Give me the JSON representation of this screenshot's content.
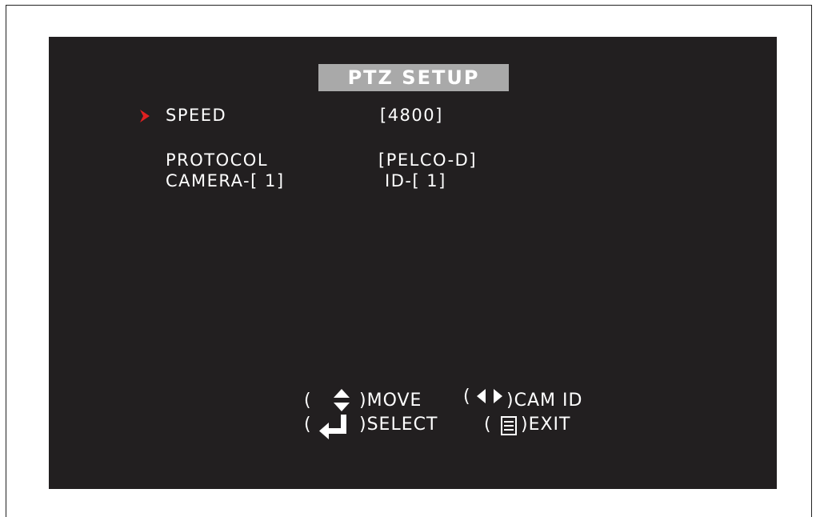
{
  "title": "PTZ SETUP",
  "menu": {
    "cursor_icon": "chevron-right-icon",
    "cursor_color": "#e02020",
    "speed_label": "SPEED",
    "speed_value": "[4800]",
    "protocol_label": "PROTOCOL",
    "protocol_value": "[PELCO-D]",
    "camera_label": "CAMERA-[ 1]",
    "id_label": "ID-[ 1]"
  },
  "hints": {
    "move_label": ")MOVE",
    "camid_label": ")CAM ID",
    "select_label": ")SELECT",
    "exit_label": ")EXIT",
    "open_paren": "("
  },
  "colors": {
    "screen_bg": "#221f20",
    "title_bg": "#a9a9a9",
    "text": "#ffffff"
  }
}
